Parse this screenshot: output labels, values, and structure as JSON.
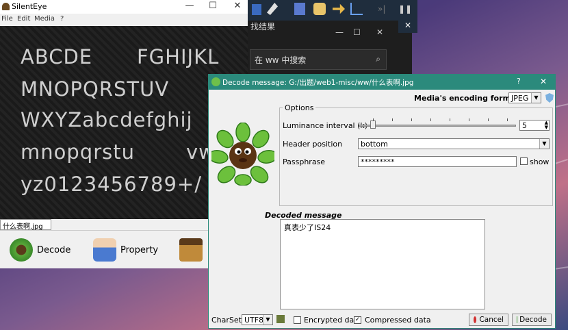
{
  "silenteye": {
    "title": "SilentEye",
    "menu": [
      "File",
      "Edit",
      "Media",
      "?"
    ],
    "image_lines": [
      "ABCDE",
      "FGHIJKL",
      "MNOPQRSTUV",
      "WXYZabcdefghij",
      "mnopqrstu",
      "vw",
      "yz0123456789+/"
    ],
    "file_tab": "什么表啊.jpg",
    "toolbar": {
      "decode_label": "Decode",
      "property_label": "Property"
    }
  },
  "background_window": {
    "title_fragment": "找结果",
    "search_text": "在 ww 中搜索"
  },
  "dialog": {
    "title": "Decode message: G:/出题/web1-misc/ww/什么表啊.jpg",
    "help_btn": "?",
    "close_btn": "✕",
    "format_label": "Media's encoding format :",
    "format_value": "JPEG",
    "options_label": "Options",
    "luminance_label": "Luminance interval (k)",
    "luminance_value": "5",
    "header_label": "Header position",
    "header_value": "bottom",
    "passphrase_label": "Passphrase",
    "passphrase_value": "*********",
    "show_label": "show",
    "decoded_label": "Decoded message",
    "decoded_text": "真表少了IS24",
    "charset_label": "CharSet:",
    "charset_value": "UTF8",
    "encrypted_label": "Encrypted data",
    "compressed_label": "Compressed data",
    "cancel_label": "Cancel",
    "decode_label": "Decode"
  },
  "colors": {
    "dialog_title": "#2b8a7c",
    "accent": "#2a8a7a"
  }
}
